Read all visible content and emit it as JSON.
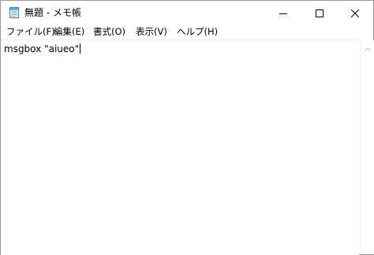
{
  "window": {
    "title": "無題 - メモ帳",
    "app_icon": "notepad-icon"
  },
  "controls": {
    "minimize_icon": "minimize-icon",
    "maximize_icon": "maximize-icon",
    "close_icon": "close-icon"
  },
  "menu": {
    "items": [
      {
        "label": "ファイル(F)"
      },
      {
        "label": "編集(E)"
      },
      {
        "label": "書式(O)"
      },
      {
        "label": "表示(V)"
      },
      {
        "label": "ヘルプ(H)"
      }
    ]
  },
  "editor": {
    "content": "msgbox \"aiueo\""
  },
  "scrollbar": {
    "up_icon": "scroll-up-arrow-icon"
  }
}
